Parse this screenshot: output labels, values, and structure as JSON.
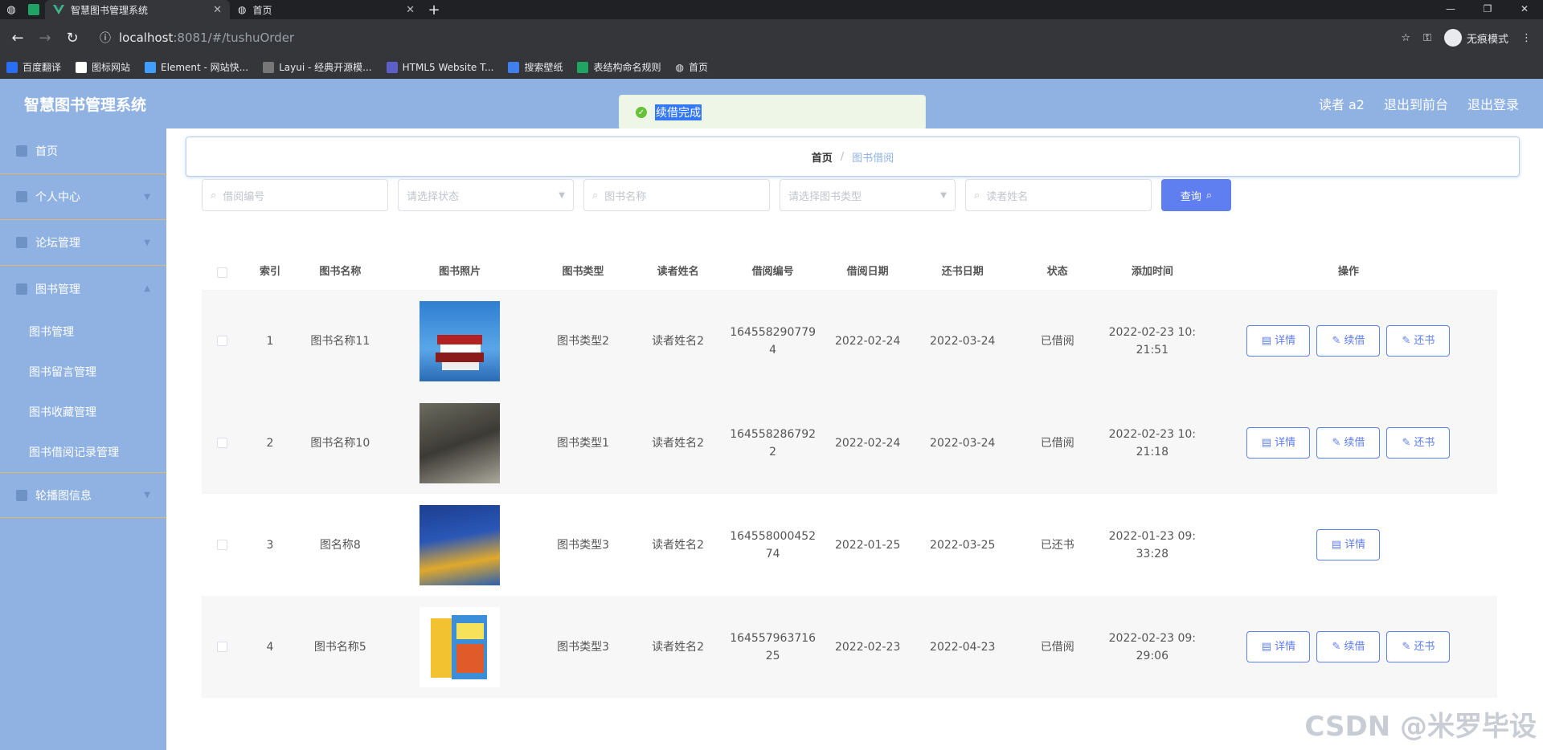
{
  "browser": {
    "tabs": [
      {
        "title": "智慧图书管理系统",
        "active": true
      },
      {
        "title": "首页",
        "active": false
      }
    ],
    "url_host": "localhost",
    "url_rest": ":8081/#/tushuOrder",
    "incognito_label": "无痕模式",
    "bookmarks": [
      "百度翻译",
      "图标网站",
      "Element - 网站快...",
      "Layui - 经典开源模...",
      "HTML5 Website T...",
      "搜索壁纸",
      "表结构命名规则",
      "首页"
    ]
  },
  "header": {
    "brand": "智慧图书管理系统",
    "user": "读者 a2",
    "back_front": "退出到前台",
    "logout": "退出登录"
  },
  "toast": {
    "text": "续借完成"
  },
  "sidebar": {
    "items": [
      {
        "label": "首页"
      },
      {
        "label": "个人中心"
      },
      {
        "label": "论坛管理"
      },
      {
        "label": "图书管理"
      }
    ],
    "sub_items": [
      "图书管理",
      "图书留言管理",
      "图书收藏管理",
      "图书借阅记录管理"
    ],
    "last_item": "轮播图信息"
  },
  "breadcrumb": {
    "home": "首页",
    "current": "图书借阅"
  },
  "filters": {
    "borrow_no": "借阅编号",
    "status": "请选择状态",
    "book_name": "图书名称",
    "book_type": "请选择图书类型",
    "reader": "读者姓名",
    "search": "查询"
  },
  "table": {
    "headers": [
      "索引",
      "图书名称",
      "图书照片",
      "图书类型",
      "读者姓名",
      "借阅编号",
      "借阅日期",
      "还书日期",
      "状态",
      "添加时间",
      "操作"
    ],
    "rows": [
      {
        "idx": "1",
        "name": "图书名称11",
        "type": "图书类型2",
        "reader": "读者姓名2",
        "no1": "164558290779",
        "no2": "4",
        "bdate": "2022-02-24",
        "rdate": "2022-03-24",
        "status": "已借阅",
        "added1": "2022-02-23 10:",
        "added2": "21:51"
      },
      {
        "idx": "2",
        "name": "图书名称10",
        "type": "图书类型1",
        "reader": "读者姓名2",
        "no1": "164558286792",
        "no2": "2",
        "bdate": "2022-02-24",
        "rdate": "2022-03-24",
        "status": "已借阅",
        "added1": "2022-02-23 10:",
        "added2": "21:18"
      },
      {
        "idx": "3",
        "name": "图名称8",
        "type": "图书类型3",
        "reader": "读者姓名2",
        "no1": "164558000452",
        "no2": "74",
        "bdate": "2022-01-25",
        "rdate": "2022-03-25",
        "status": "已还书",
        "added1": "2022-01-23 09:",
        "added2": "33:28"
      },
      {
        "idx": "4",
        "name": "图书名称5",
        "type": "图书类型3",
        "reader": "读者姓名2",
        "no1": "164557963716",
        "no2": "25",
        "bdate": "2022-02-23",
        "rdate": "2022-04-23",
        "status": "已借阅",
        "added1": "2022-02-23 09:",
        "added2": "29:06"
      }
    ],
    "ops": {
      "detail": "详情",
      "renew": "续借",
      "return": "还书"
    }
  },
  "watermark": "CSDN @米罗毕设",
  "colors": {
    "primary": "#5f7ef0",
    "header": "#8fb2e3",
    "success": "#67c23a"
  }
}
